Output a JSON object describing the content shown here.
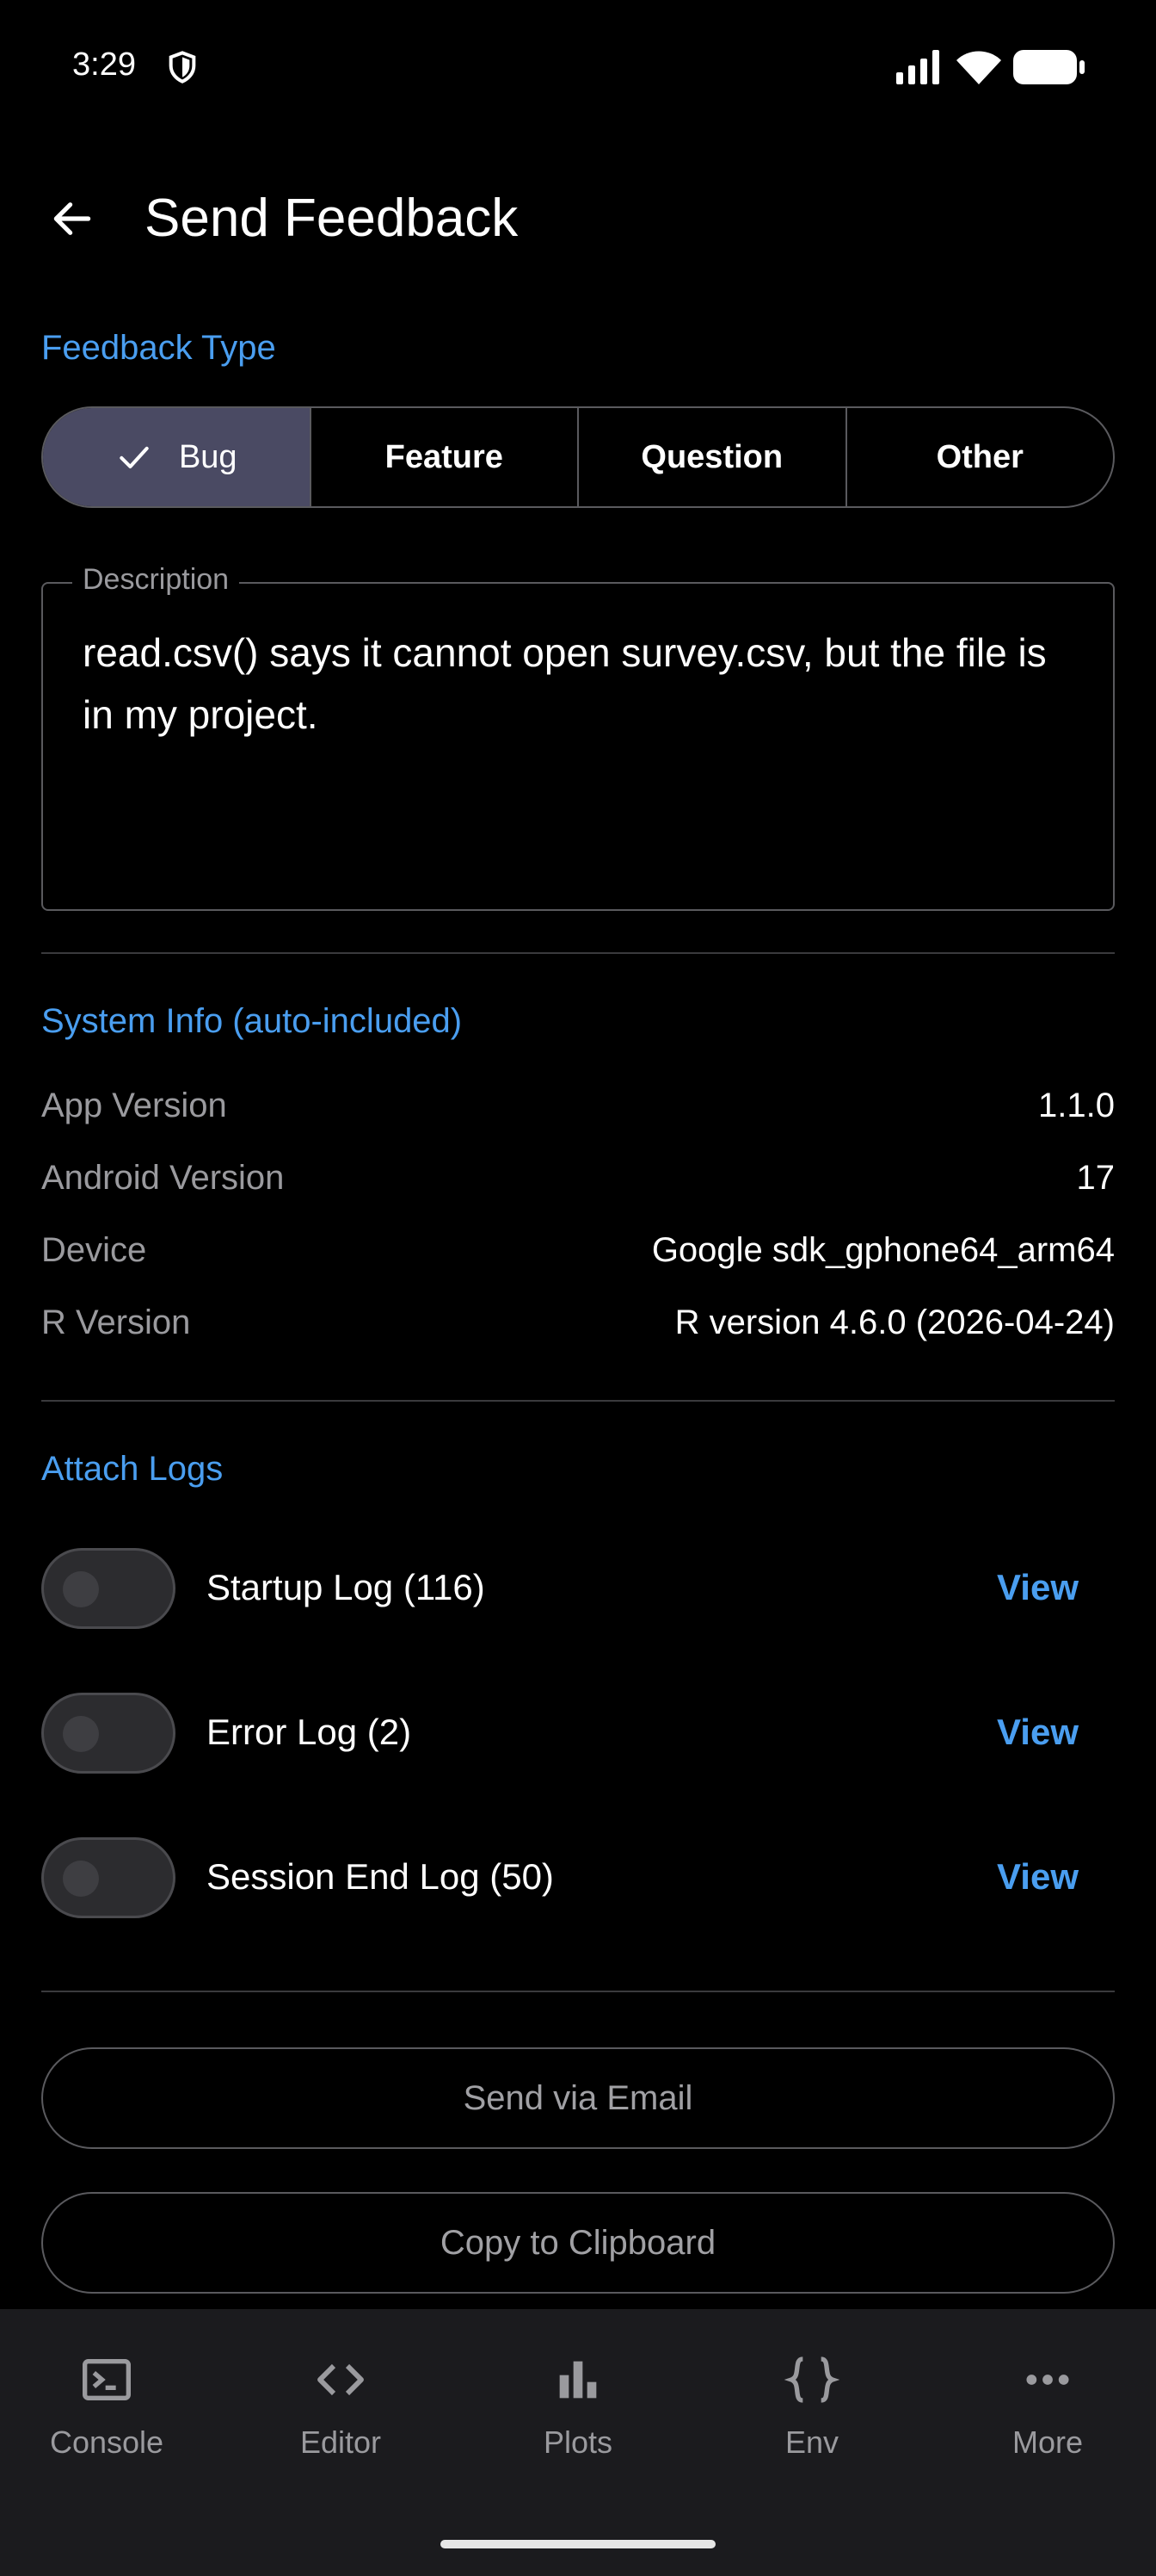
{
  "status_bar": {
    "time": "3:29"
  },
  "app_bar": {
    "title": "Send Feedback"
  },
  "feedback_type": {
    "label": "Feedback Type",
    "options": [
      "Bug",
      "Feature",
      "Question",
      "Other"
    ],
    "selected": "Bug"
  },
  "description": {
    "label": "Description",
    "value": "read.csv() says it cannot open survey.csv, but the file is in my project."
  },
  "system_info": {
    "label": "System Info (auto-included)",
    "rows": [
      {
        "label": "App Version",
        "value": "1.1.0"
      },
      {
        "label": "Android Version",
        "value": "17"
      },
      {
        "label": "Device",
        "value": "Google sdk_gphone64_arm64"
      },
      {
        "label": "R Version",
        "value": "R version 4.6.0 (2026-04-24)"
      }
    ]
  },
  "attach_logs": {
    "label": "Attach Logs",
    "items": [
      {
        "label": "Startup Log (116)",
        "action": "View",
        "enabled": false
      },
      {
        "label": "Error Log (2)",
        "action": "View",
        "enabled": false
      },
      {
        "label": "Session End Log (50)",
        "action": "View",
        "enabled": false
      }
    ]
  },
  "actions": {
    "send_email": "Send via Email",
    "copy_clipboard": "Copy to Clipboard"
  },
  "bottom_nav": {
    "items": [
      {
        "label": "Console",
        "icon": "console-icon"
      },
      {
        "label": "Editor",
        "icon": "code-icon"
      },
      {
        "label": "Plots",
        "icon": "bar-chart-icon"
      },
      {
        "label": "Env",
        "icon": "braces-icon"
      },
      {
        "label": "More",
        "icon": "more-dots-icon"
      }
    ]
  },
  "colors": {
    "accent": "#4a9ef0",
    "selected_segment": "#4a4a63",
    "background": "#000000",
    "nav_background": "#1b1b1e"
  }
}
